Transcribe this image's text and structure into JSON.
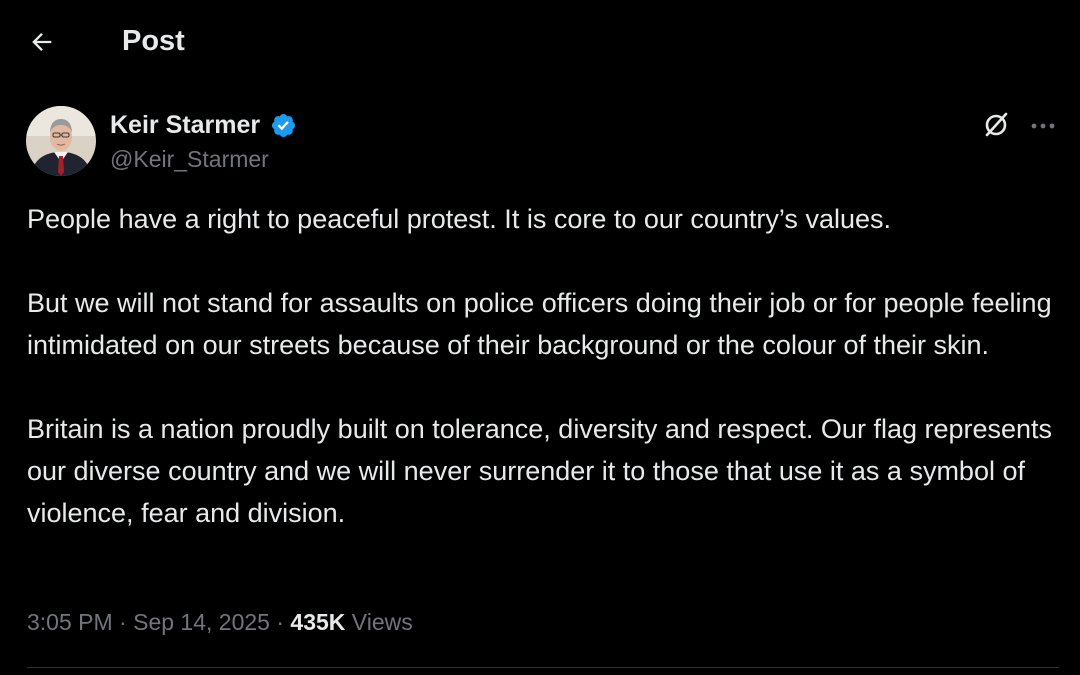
{
  "header": {
    "title": "Post",
    "back_icon": "arrow-left-icon"
  },
  "author": {
    "display_name": "Keir Starmer",
    "handle": "@Keir_Starmer",
    "verified": true,
    "verified_color": "#1d9bf0",
    "avatar_icon": "avatar-portrait",
    "grok_icon": "grok-icon",
    "more_icon": "more-horizontal-icon"
  },
  "post": {
    "paragraphs": [
      "People have a right to peaceful protest. It is core to our country’s values.",
      "But we will not stand for assaults on police officers doing their job or for people feeling intimidated on our streets because of their background or the colour of their skin.",
      "Britain is a nation proudly built on tolerance, diversity and respect. Our flag represents our diverse country and we will never surrender it to those that use it as a symbol of violence, fear and division."
    ],
    "time": "3:05 PM",
    "separator": "·",
    "date": "Sep 14, 2025",
    "views_count": "435K",
    "views_label": "Views"
  },
  "colors": {
    "background": "#000000",
    "text_primary": "#e7e9ea",
    "text_secondary": "#71767b",
    "divider": "#2f3336"
  }
}
